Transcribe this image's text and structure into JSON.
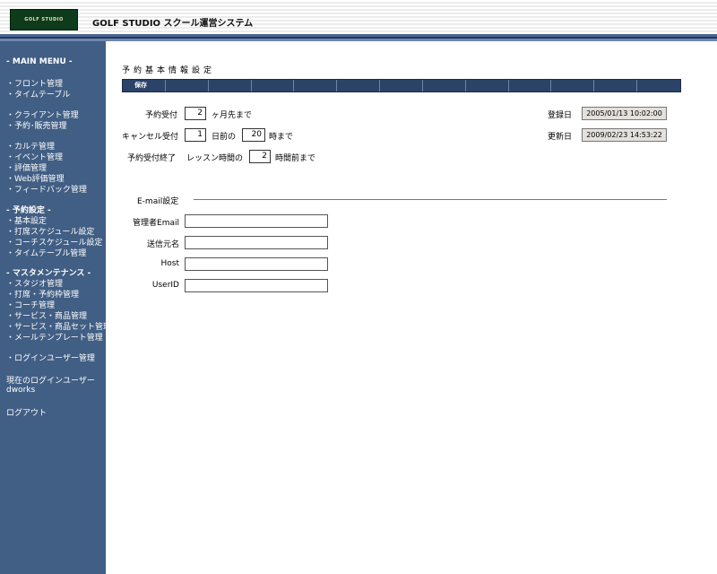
{
  "header": {
    "logo_text": "GOLF STUDIO",
    "title": "GOLF STUDIO スクール運営システム"
  },
  "sidebar": {
    "main_menu_title": "- MAIN MENU -",
    "group1": [
      "・フロント管理",
      "・タイムテーブル"
    ],
    "group2": [
      "・クライアント管理",
      "・予約･販売管理"
    ],
    "group3": [
      "・カルテ管理",
      "・イベント管理",
      "・評価管理",
      "・Web評価管理",
      "・フィードバック管理"
    ],
    "reservation_title": "- 予約設定 -",
    "group4": [
      "・基本設定",
      "・打席スケジュール設定",
      "・コーチスケジュール設定",
      "・タイムテーブル管理"
    ],
    "master_title": "- マスタメンテナンス -",
    "group5": [
      "・スタジオ管理",
      "・打席・予約枠管理",
      "・コーチ管理",
      "・サービス・商品管理",
      "・サービス・商品セット管理",
      "・メールテンプレート管理"
    ],
    "login_user_mgmt": "・ログインユーザー管理",
    "current_user_label": "現在のログインユーザー",
    "current_user": "dworks",
    "logout": "ログアウト"
  },
  "main": {
    "page_title": "予約基本情報設定",
    "toolbar": {
      "save_label": "保存"
    },
    "reservation": {
      "accept_label": "予約受付",
      "accept_value": "2",
      "accept_unit": "ヶ月先まで",
      "cancel_label": "キャンセル受付",
      "cancel_days": "1",
      "cancel_days_unit": "日前の",
      "cancel_hour": "20",
      "cancel_hour_unit": "時まで",
      "end_label": "予約受付終了",
      "end_prefix": "レッスン時間の",
      "end_value": "2",
      "end_unit": "時間前まで"
    },
    "dates": {
      "registered_label": "登録日",
      "registered_value": "2005/01/13 10:02:00",
      "updated_label": "更新日",
      "updated_value": "2009/02/23 14:53:22"
    },
    "email": {
      "section_title": "E-mail設定",
      "admin_label": "管理者Email",
      "admin_value": "",
      "sender_label": "送信元名",
      "sender_value": "",
      "host_label": "Host",
      "host_value": "",
      "userid_label": "UserID",
      "userid_value": ""
    }
  }
}
